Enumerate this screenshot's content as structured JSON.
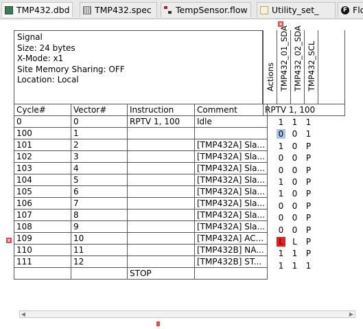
{
  "tabs": [
    {
      "label": "TMP432.dbd",
      "icon": "database-icon"
    },
    {
      "label": "TMP432.spec",
      "icon": "spec-grid-icon"
    },
    {
      "label": "TempSensor.flow",
      "icon": "flow-icon"
    },
    {
      "label": "Utility_set_",
      "icon": "utility-doc-icon"
    },
    {
      "label": "Flo",
      "icon": "flow-f-icon"
    }
  ],
  "signal": {
    "title": "Signal",
    "size": "Size: 24 bytes",
    "xmode": "X-Mode: x1",
    "sharing": "Site Memory Sharing: OFF",
    "location": "Location: Local"
  },
  "columns": {
    "cycle": "Cycle#",
    "vector": "Vector#",
    "instruction": "Instruction",
    "comment": "Comment",
    "actions": "Actions",
    "pins": [
      "TMP432_01_SDA",
      "TMP432_02_SDA",
      "TMP432_SCL"
    ]
  },
  "rptv_label": "RPTV 1, 100",
  "rows": [
    {
      "cycle": "0",
      "vector": "0",
      "instruction": "RPTV 1, 100",
      "comment": "Idle",
      "v": [
        "1",
        "1",
        "1"
      ]
    },
    {
      "cycle": "100",
      "vector": "1",
      "instruction": "",
      "comment": "",
      "v": [
        "0",
        "0",
        "1"
      ]
    },
    {
      "cycle": "101",
      "vector": "2",
      "instruction": "",
      "comment": "[TMP432A] Sla...",
      "v": [
        "1",
        "0",
        "P"
      ]
    },
    {
      "cycle": "102",
      "vector": "3",
      "instruction": "",
      "comment": "[TMP432A] Sla...",
      "v": [
        "0",
        "0",
        "P"
      ]
    },
    {
      "cycle": "103",
      "vector": "4",
      "instruction": "",
      "comment": "[TMP432A] Sla...",
      "v": [
        "0",
        "0",
        "P"
      ]
    },
    {
      "cycle": "104",
      "vector": "5",
      "instruction": "",
      "comment": "[TMP432A] Sla...",
      "v": [
        "1",
        "0",
        "P"
      ]
    },
    {
      "cycle": "105",
      "vector": "6",
      "instruction": "",
      "comment": "[TMP432A] Sla...",
      "v": [
        "1",
        "0",
        "P"
      ]
    },
    {
      "cycle": "106",
      "vector": "7",
      "instruction": "",
      "comment": "[TMP432A] Sla...",
      "v": [
        "0",
        "0",
        "P"
      ]
    },
    {
      "cycle": "107",
      "vector": "8",
      "instruction": "",
      "comment": "[TMP432A] Sla...",
      "v": [
        "0",
        "0",
        "P"
      ]
    },
    {
      "cycle": "108",
      "vector": "9",
      "instruction": "",
      "comment": "[TMP432A] Sla...",
      "v": [
        "0",
        "0",
        "P"
      ]
    },
    {
      "cycle": "109",
      "vector": "10",
      "instruction": "",
      "comment": "[TMP432A] AC...",
      "v": [
        "L",
        "L",
        "P"
      ]
    },
    {
      "cycle": "110",
      "vector": "11",
      "instruction": "",
      "comment": "[TMP432B] NA...",
      "v": [
        "1",
        "1",
        "P"
      ]
    },
    {
      "cycle": "111",
      "vector": "12",
      "instruction": "",
      "comment": "[TMP432B] ST...",
      "v": [
        "1",
        "1",
        "1"
      ]
    },
    {
      "cycle": "",
      "vector": "",
      "instruction": "STOP",
      "comment": "",
      "v": [
        "",
        "",
        ""
      ]
    }
  ],
  "colors": {
    "error_cell": "#ee1c1c",
    "selected_cell": "#a9c5e8",
    "marker": "#e54b4b"
  },
  "markers": {
    "x_glyph": "x"
  }
}
